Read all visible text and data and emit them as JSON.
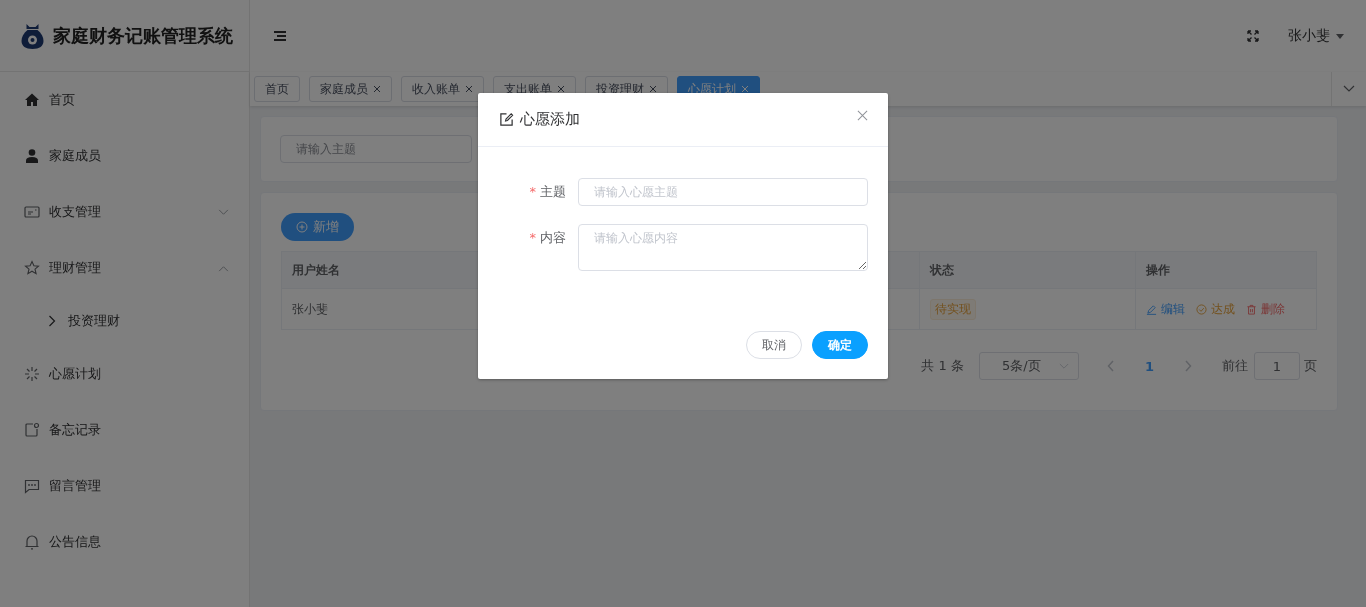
{
  "header": {
    "app_title": "家庭财务记账管理系统",
    "user": "张小斐"
  },
  "sidebar": {
    "items": [
      {
        "label": "首页",
        "kind": "home"
      },
      {
        "label": "家庭成员",
        "kind": "user"
      },
      {
        "label": "收支管理",
        "kind": "card",
        "expanded": false
      },
      {
        "label": "理财管理",
        "kind": "star",
        "expanded": true,
        "children": [
          {
            "label": "投资理财"
          }
        ]
      },
      {
        "label": "心愿计划",
        "kind": "sparkle"
      },
      {
        "label": "备忘记录",
        "kind": "note"
      },
      {
        "label": "留言管理",
        "kind": "chat"
      },
      {
        "label": "公告信息",
        "kind": "bell"
      }
    ]
  },
  "tabs": [
    {
      "label": "首页",
      "selected": false,
      "closable": false
    },
    {
      "label": "家庭成员",
      "selected": false,
      "closable": true
    },
    {
      "label": "收入账单",
      "selected": false,
      "closable": true
    },
    {
      "label": "支出账单",
      "selected": false,
      "closable": true
    },
    {
      "label": "投资理财",
      "selected": false,
      "closable": true
    },
    {
      "label": "心愿计划",
      "selected": true,
      "closable": true
    }
  ],
  "search": {
    "placeholder": "请输入主题"
  },
  "add_button": "新增",
  "table": {
    "columns": [
      "用户姓名",
      "状态",
      "操作"
    ],
    "rows": [
      {
        "name": "张小斐",
        "status": "待实现",
        "actions": [
          {
            "kind": "edit",
            "label": "编辑"
          },
          {
            "kind": "done",
            "label": "达成"
          },
          {
            "kind": "delete",
            "label": "删除"
          }
        ]
      }
    ]
  },
  "pagination": {
    "total": "共 1 条",
    "page_size": "5条/页",
    "pages": [
      {
        "label": "1",
        "selected": true
      }
    ],
    "goto_label": "前往",
    "goto_value": "1",
    "goto_suffix": "页"
  },
  "dialog": {
    "title": "心愿添加",
    "fields": [
      {
        "kind": "input",
        "label": "主题",
        "required_mark": "*",
        "placeholder": "请输入心愿主题"
      },
      {
        "kind": "textarea",
        "label": "内容",
        "required_mark": "*",
        "placeholder": "请输入心愿内容"
      }
    ],
    "buttons": [
      {
        "label": "取消",
        "kind": "default"
      },
      {
        "label": "确定",
        "kind": "primary"
      }
    ]
  }
}
